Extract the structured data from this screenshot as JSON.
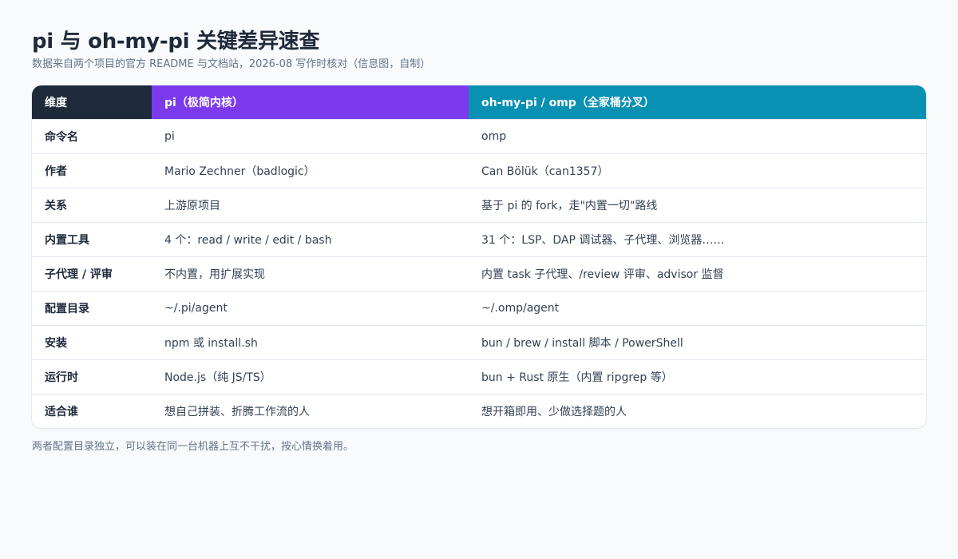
{
  "header": {
    "title": "pi 与 oh-my-pi 关键差异速查",
    "subtitle": "数据来自两个项目的官方 README 与文档站，2026-08 写作时核对（信息图，自制）"
  },
  "table": {
    "headers": [
      "维度",
      "pi（极简内核）",
      "oh-my-pi / omp（全家桶分叉）"
    ],
    "header_colors": [
      "#1e293b",
      "#7c3aed",
      "#0891b2"
    ],
    "rows": [
      [
        "命令名",
        "pi",
        "omp"
      ],
      [
        "作者",
        "Mario Zechner（badlogic）",
        "Can Bölük（can1357）"
      ],
      [
        "关系",
        "上游原项目",
        "基于 pi 的 fork，走\"内置一切\"路线"
      ],
      [
        "内置工具",
        "4 个：read / write / edit / bash",
        "31 个：LSP、DAP 调试器、子代理、浏览器……"
      ],
      [
        "子代理 / 评审",
        "不内置，用扩展实现",
        "内置 task 子代理、/review 评审、advisor 监督"
      ],
      [
        "配置目录",
        "~/.pi/agent",
        "~/.omp/agent"
      ],
      [
        "安装",
        "npm 或 install.sh",
        "bun / brew / install 脚本 / PowerShell"
      ],
      [
        "运行时",
        "Node.js（纯 JS/TS）",
        "bun + Rust 原生（内置 ripgrep 等）"
      ],
      [
        "适合谁",
        "想自己拼装、折腾工作流的人",
        "想开箱即用、少做选择题的人"
      ]
    ]
  },
  "footnote": "两者配置目录独立，可以装在同一台机器上互不干扰，按心情换着用。"
}
